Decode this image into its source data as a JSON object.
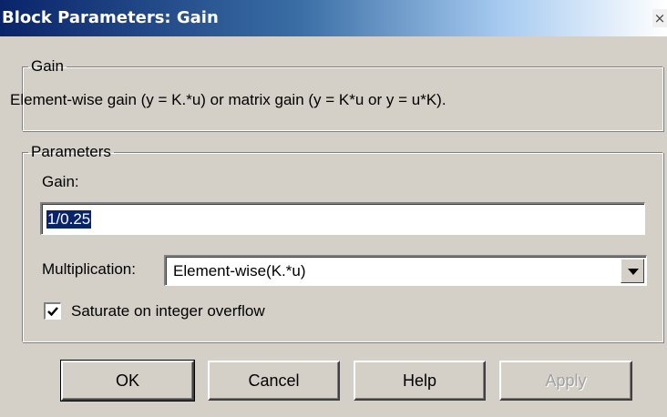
{
  "window": {
    "title": "Block Parameters: Gain",
    "close_glyph": "×"
  },
  "gain_group": {
    "legend": "Gain",
    "description": "Element-wise gain (y = K.*u) or matrix gain (y = K*u or y = u*K)."
  },
  "parameters_group": {
    "legend": "Parameters",
    "gain_label": "Gain:",
    "gain_value": "1/0.25",
    "multiplication_label": "Multiplication:",
    "multiplication_value": "Element-wise(K.*u)",
    "saturate_label": "Saturate on integer overflow",
    "saturate_checked": true
  },
  "buttons": {
    "ok": "OK",
    "cancel": "Cancel",
    "help": "Help",
    "apply": "Apply",
    "apply_enabled": false
  },
  "colors": {
    "dialog_bg": "#d4d0c8",
    "titlebar_start": "#0a246a",
    "selection": "#0a246a"
  }
}
